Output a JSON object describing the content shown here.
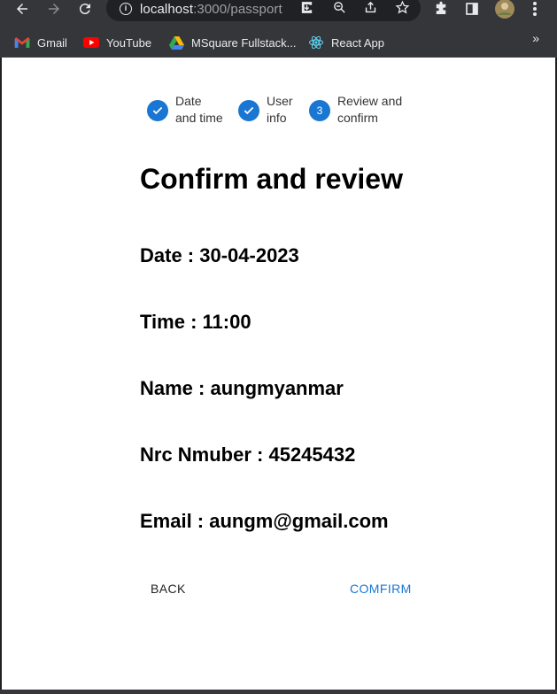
{
  "browser": {
    "url_host": "localhost",
    "url_path": ":3000/passport",
    "bookmarks": [
      {
        "label": "Gmail",
        "icon": "gmail-icon"
      },
      {
        "label": "YouTube",
        "icon": "youtube-icon"
      },
      {
        "label": "MSquare Fullstack...",
        "icon": "google-drive-icon"
      },
      {
        "label": "React App",
        "icon": "react-icon"
      }
    ],
    "bookmarks_more": "»"
  },
  "stepper": {
    "steps": [
      {
        "line1": "Date",
        "line2": "and time",
        "state": "completed"
      },
      {
        "line1": "User",
        "line2": "info",
        "state": "completed"
      },
      {
        "number": "3",
        "line1": "Review and",
        "line2": "confirm",
        "state": "active"
      }
    ]
  },
  "review": {
    "heading": "Confirm and review",
    "date": "Date : 30-04-2023",
    "time": "Time : 11:00",
    "name": "Name : aungmyanmar",
    "nrc": "Nrc Nmuber : 45245432",
    "email": "Email : aungm@gmail.com"
  },
  "actions": {
    "back_label": "BACK",
    "confirm_label": "COMFIRM"
  },
  "colors": {
    "accent": "#1976d2",
    "chrome": "#35363a",
    "omnibox": "#202124"
  }
}
